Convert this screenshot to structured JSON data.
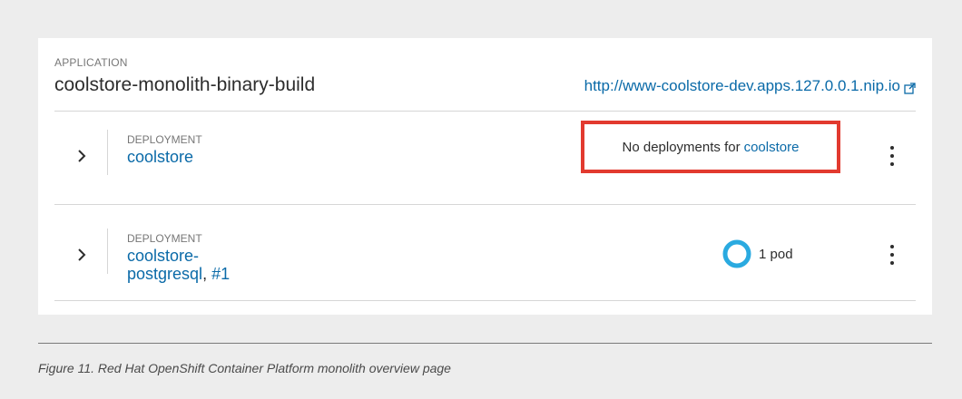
{
  "application": {
    "label": "APPLICATION",
    "name": "coolstore-monolith-binary-build",
    "route": "http://www-coolstore-dev.apps.127.0.0.1.nip.io"
  },
  "deployments": [
    {
      "label": "DEPLOYMENT",
      "name": "coolstore",
      "status_prefix": "No deployments for",
      "status_link": "coolstore"
    },
    {
      "label": "DEPLOYMENT",
      "name": "coolstore-postgresql",
      "separator": ", ",
      "revision": "#1",
      "pod_count": "1 pod"
    }
  ],
  "colors": {
    "accent": "#0a6aa8",
    "highlight_box": "#e23a2f",
    "pod_ring": "#2aaae0"
  },
  "caption": "Figure 11. Red Hat OpenShift Container Platform monolith overview page"
}
